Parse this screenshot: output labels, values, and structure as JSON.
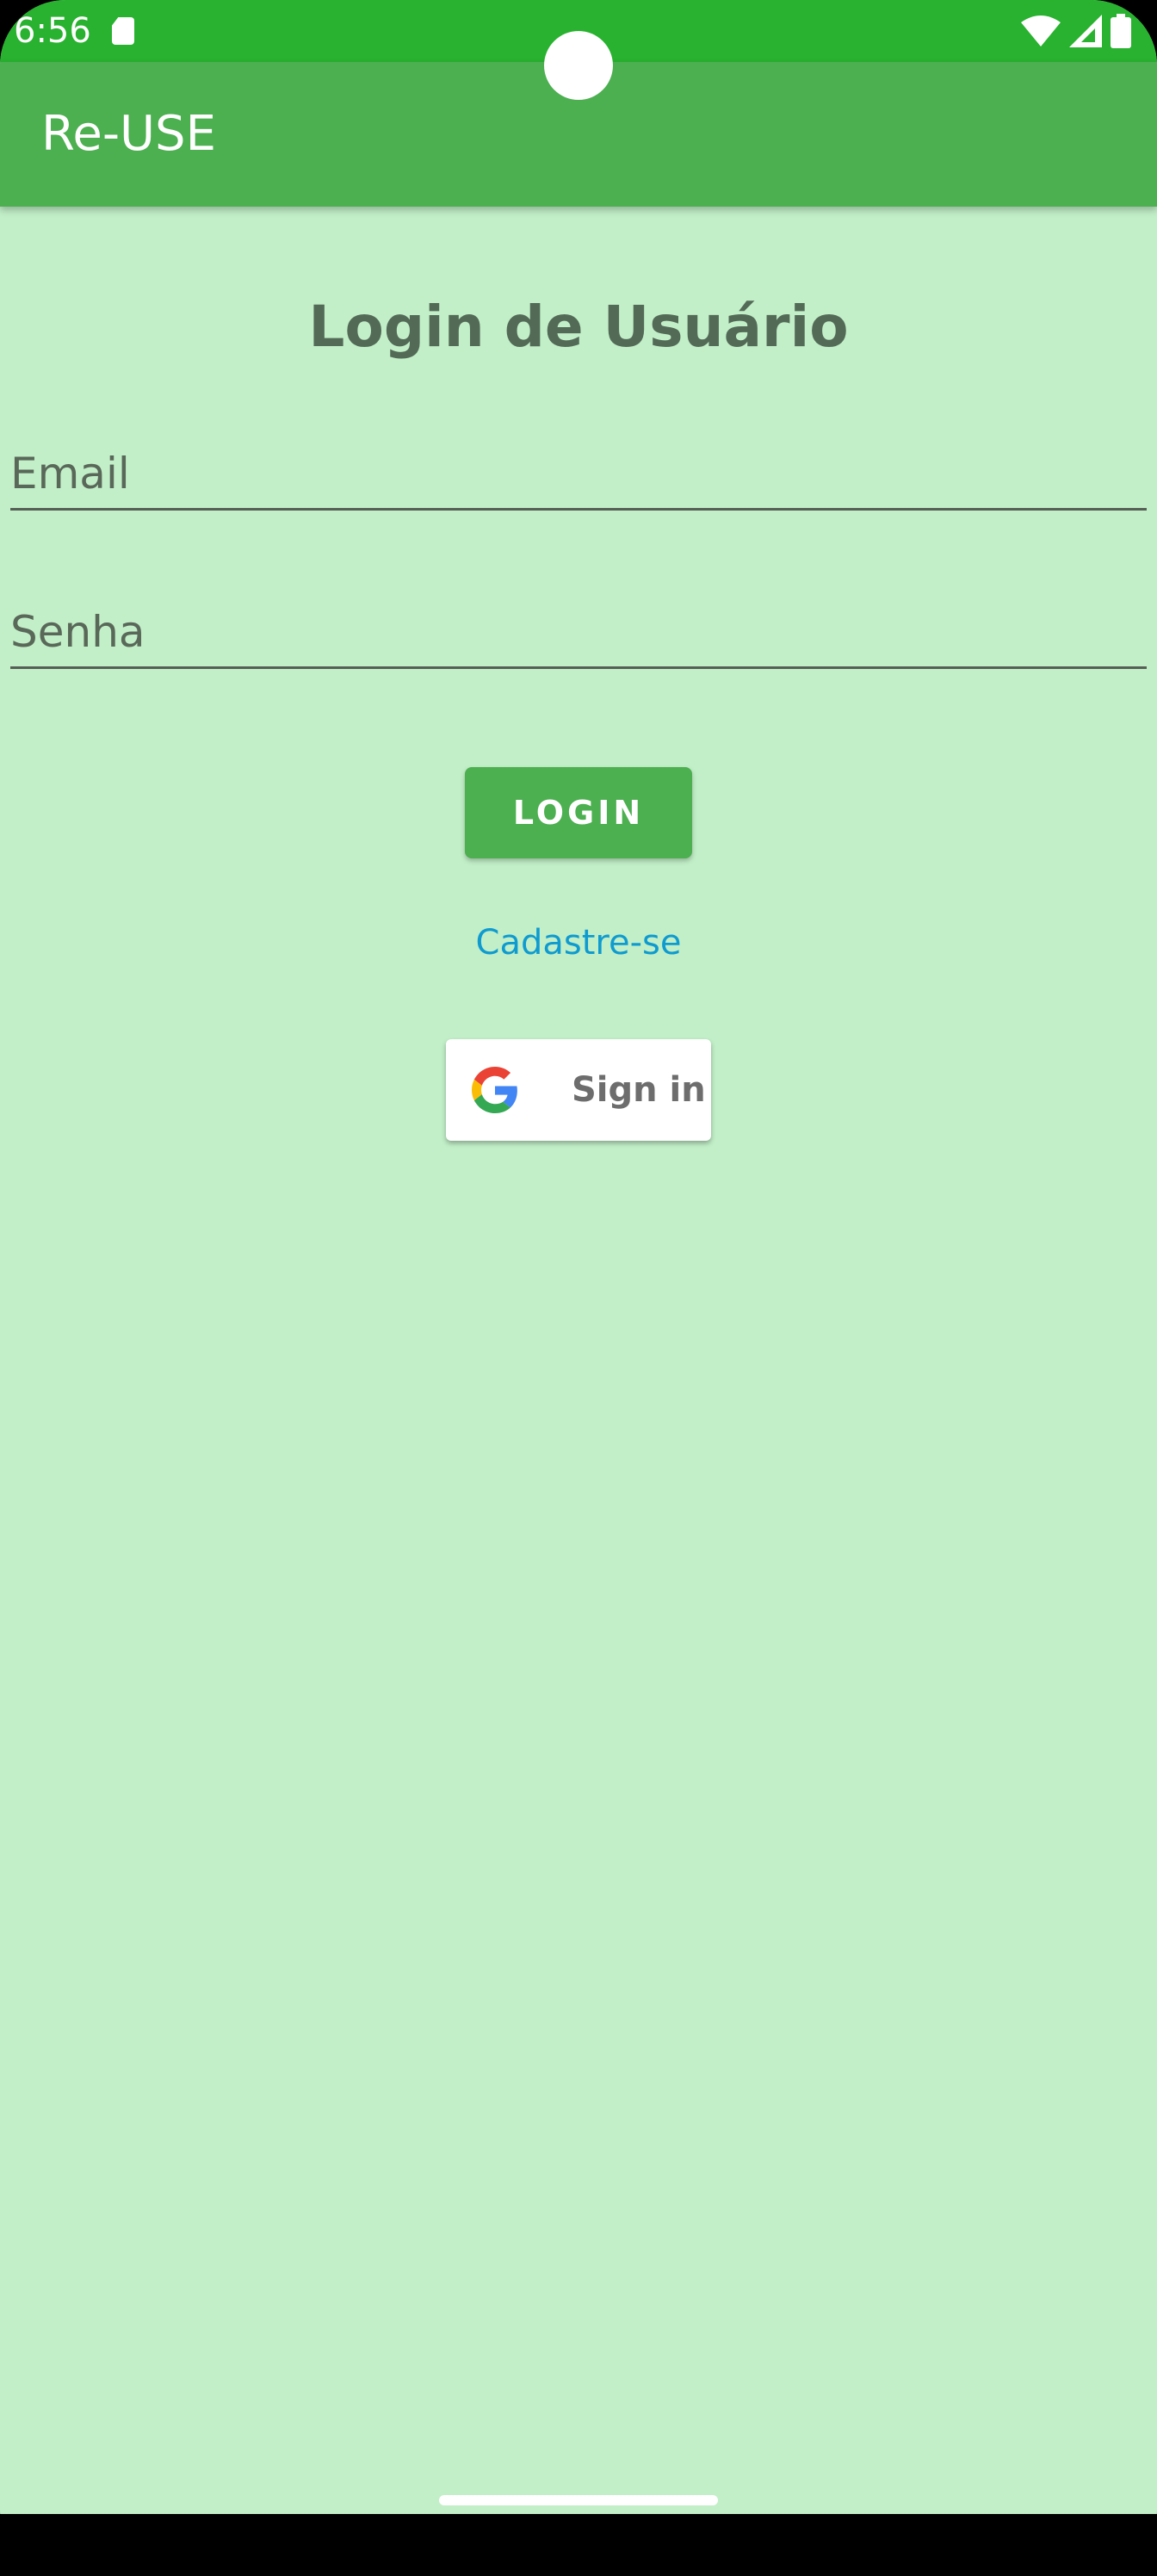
{
  "status_bar": {
    "time": "6:56",
    "icons": [
      "sd-card-icon",
      "wifi-icon",
      "cell-signal-icon",
      "battery-icon"
    ]
  },
  "app_bar": {
    "title": "Re-USE"
  },
  "login": {
    "title": "Login de Usuário",
    "email_placeholder": "Email",
    "password_placeholder": "Senha",
    "login_button": "LOGIN",
    "signup_link": "Cadastre-se",
    "google_button": "Sign in"
  },
  "colors": {
    "status_bar": "#28b22f",
    "app_bar": "#4caf50",
    "background": "#c2efc8",
    "link": "#0f9bd0"
  }
}
